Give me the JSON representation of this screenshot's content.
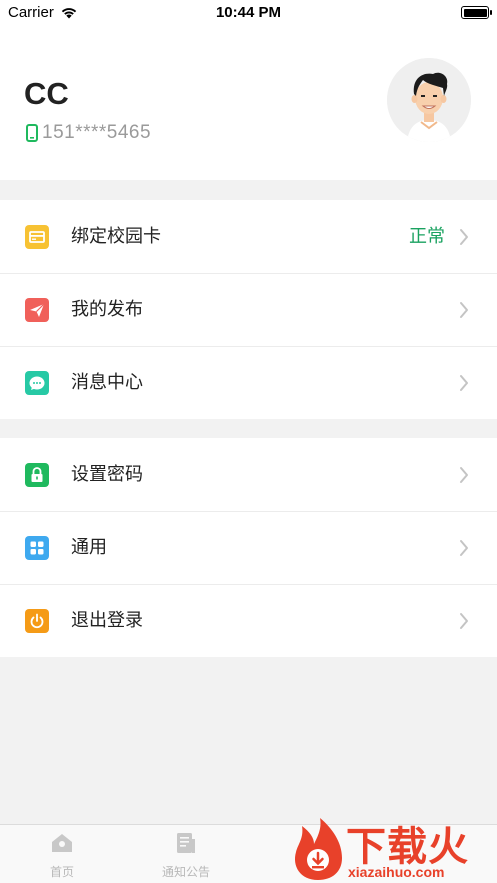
{
  "status_bar": {
    "carrier": "Carrier",
    "time": "10:44 PM"
  },
  "profile": {
    "name": "CC",
    "phone": "151****5465"
  },
  "menu_group_1": [
    {
      "label": "绑定校园卡",
      "status": "正常",
      "icon": "campus-card-icon",
      "color": "#f7c233"
    },
    {
      "label": "我的发布",
      "status": "",
      "icon": "paper-plane-icon",
      "color": "#f0605a"
    },
    {
      "label": "消息中心",
      "status": "",
      "icon": "message-bubble-icon",
      "color": "#27c9a5"
    }
  ],
  "menu_group_2": [
    {
      "label": "设置密码",
      "icon": "lock-icon",
      "color": "#1fb95e"
    },
    {
      "label": "通用",
      "icon": "grid-icon",
      "color": "#3ea9ef"
    },
    {
      "label": "退出登录",
      "icon": "power-icon",
      "color": "#f59b17"
    }
  ],
  "tabbar": [
    {
      "label": "首页",
      "icon": "home-icon"
    },
    {
      "label": "通知公告",
      "icon": "document-icon"
    }
  ],
  "watermark": {
    "cn": "下载火",
    "en": "xiazaihuo.com"
  },
  "colors": {
    "status_ok": "#1aa260",
    "background": "#f2f2f2"
  }
}
